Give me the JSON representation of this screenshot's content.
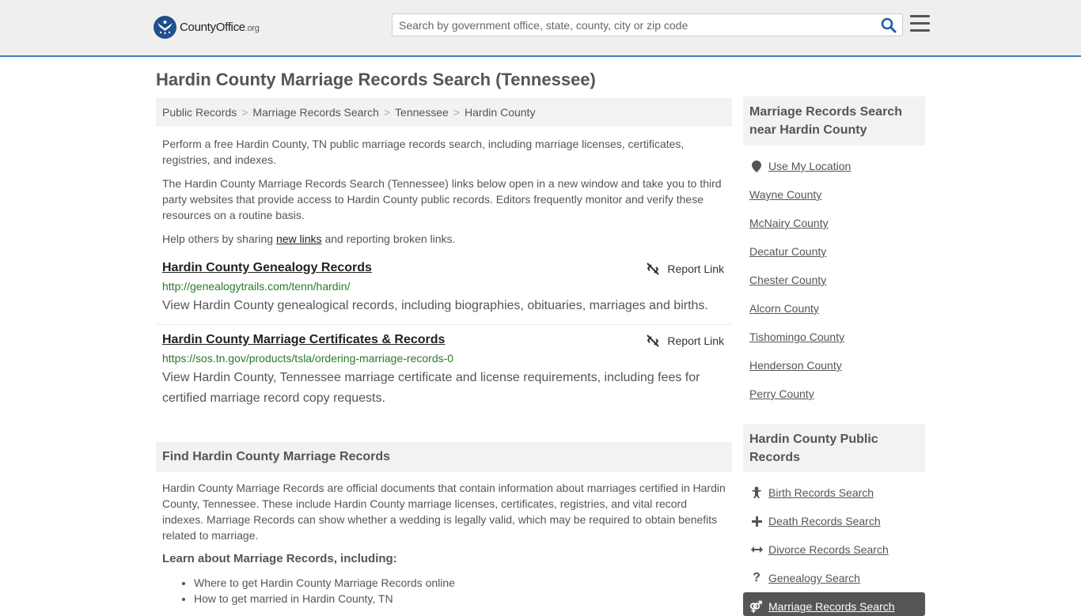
{
  "header": {
    "logo_main": "CountyOffice",
    "logo_tld": ".org",
    "search_placeholder": "Search by government office, state, county, city or zip code"
  },
  "page_title": "Hardin County Marriage Records Search (Tennessee)",
  "breadcrumb": [
    "Public Records",
    "Marriage Records Search",
    "Tennessee",
    "Hardin County"
  ],
  "intro": {
    "p1": "Perform a free Hardin County, TN public marriage records search, including marriage licenses, certificates, registries, and indexes.",
    "p2": "The Hardin County Marriage Records Search (Tennessee) links below open in a new window and take you to third party websites that provide access to Hardin County public records. Editors frequently monitor and verify these resources on a routine basis.",
    "p3_before": "Help others by sharing ",
    "p3_link": "new links",
    "p3_after": " and reporting broken links."
  },
  "results": [
    {
      "title": "Hardin County Genealogy Records",
      "url": "http://genealogytrails.com/tenn/hardin/",
      "desc": "View Hardin County genealogical records, including biographies, obituaries, marriages and births.",
      "report": "Report Link"
    },
    {
      "title": "Hardin County Marriage Certificates & Records",
      "url": "https://sos.tn.gov/products/tsla/ordering-marriage-records-0",
      "desc": "View Hardin County, Tennessee marriage certificate and license requirements, including fees for certified marriage record copy requests.",
      "report": "Report Link"
    }
  ],
  "find": {
    "heading": "Find Hardin County Marriage Records",
    "body": "Hardin County Marriage Records are official documents that contain information about marriages certified in Hardin County, Tennessee. These include Hardin County marriage licenses, certificates, registries, and vital record indexes. Marriage Records can show whether a wedding is legally valid, which may be required to obtain benefits related to marriage.",
    "learn_heading": "Learn about Marriage Records, including:",
    "learn_items": [
      "Where to get Hardin County Marriage Records online",
      "How to get married in Hardin County, TN"
    ]
  },
  "sidebar": {
    "nearby_heading": "Marriage Records Search near Hardin County",
    "use_location": "Use My Location",
    "nearby": [
      "Wayne County",
      "McNairy County",
      "Decatur County",
      "Chester County",
      "Alcorn County",
      "Tishomingo County",
      "Henderson County",
      "Perry County"
    ],
    "public_heading": "Hardin County Public Records",
    "public_items": [
      {
        "label": "Birth Records Search",
        "icon": "baby-icon"
      },
      {
        "label": "Death Records Search",
        "icon": "cross-icon"
      },
      {
        "label": "Divorce Records Search",
        "icon": "arrows-icon"
      },
      {
        "label": "Genealogy Search",
        "icon": "question-icon"
      }
    ],
    "active_item": "Marriage Records Search"
  }
}
